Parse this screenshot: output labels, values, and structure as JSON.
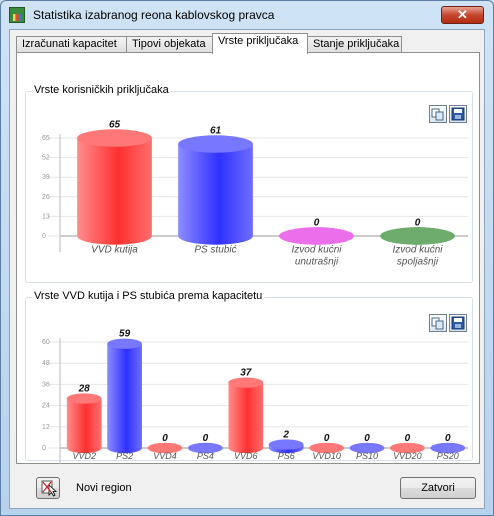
{
  "window": {
    "title": "Statistika izabranog reona kablovskog pravca",
    "close_glyph": "✕"
  },
  "tabs": [
    {
      "label": "Izračunati kapacitet",
      "active": false
    },
    {
      "label": "Tipovi objekata",
      "active": false
    },
    {
      "label": "Vrste priključaka",
      "active": true
    },
    {
      "label": "Stanje priključaka",
      "active": false
    }
  ],
  "groups": {
    "top": {
      "title": "Vrste korisničkih priključaka"
    },
    "bottom": {
      "title": "Vrste VVD kutija i PS stubića prema kapacitetu"
    }
  },
  "buttons": {
    "novi_region": "Novi region",
    "zatvori": "Zatvori"
  },
  "chart_data": [
    {
      "type": "bar",
      "categories": [
        "VVD kutija",
        "PS stubić",
        "Izvod kućni unutrašnji",
        "Izvod kućni spoljašnji"
      ],
      "category_lines": [
        [
          "VVD kutija"
        ],
        [
          "PS stubić"
        ],
        [
          "Izvod kućni",
          "unutrašnji"
        ],
        [
          "Izvod kućni",
          "spoljašnji"
        ]
      ],
      "values": [
        65,
        61,
        0,
        0
      ],
      "colors": [
        "#ff3030",
        "#3030ff",
        "#e020e0",
        "#208020"
      ],
      "yticks": [
        0,
        13,
        26,
        39,
        52,
        65
      ],
      "ylim": [
        0,
        65
      ],
      "grid": true
    },
    {
      "type": "bar",
      "categories": [
        "VVD2",
        "PS2",
        "VVD4",
        "PS4",
        "VVD6",
        "PS6",
        "VVD10",
        "PS10",
        "VVD20",
        "PS20"
      ],
      "values": [
        28,
        59,
        0,
        0,
        37,
        2,
        0,
        0,
        0,
        0
      ],
      "colors": [
        "#ff3030",
        "#3030ff",
        "#ff3030",
        "#3030ff",
        "#ff3030",
        "#3030ff",
        "#ff3030",
        "#3030ff",
        "#ff3030",
        "#3030ff"
      ],
      "yticks": [
        0,
        12,
        24,
        36,
        48,
        60
      ],
      "ylim": [
        0,
        60
      ],
      "grid": true
    }
  ]
}
